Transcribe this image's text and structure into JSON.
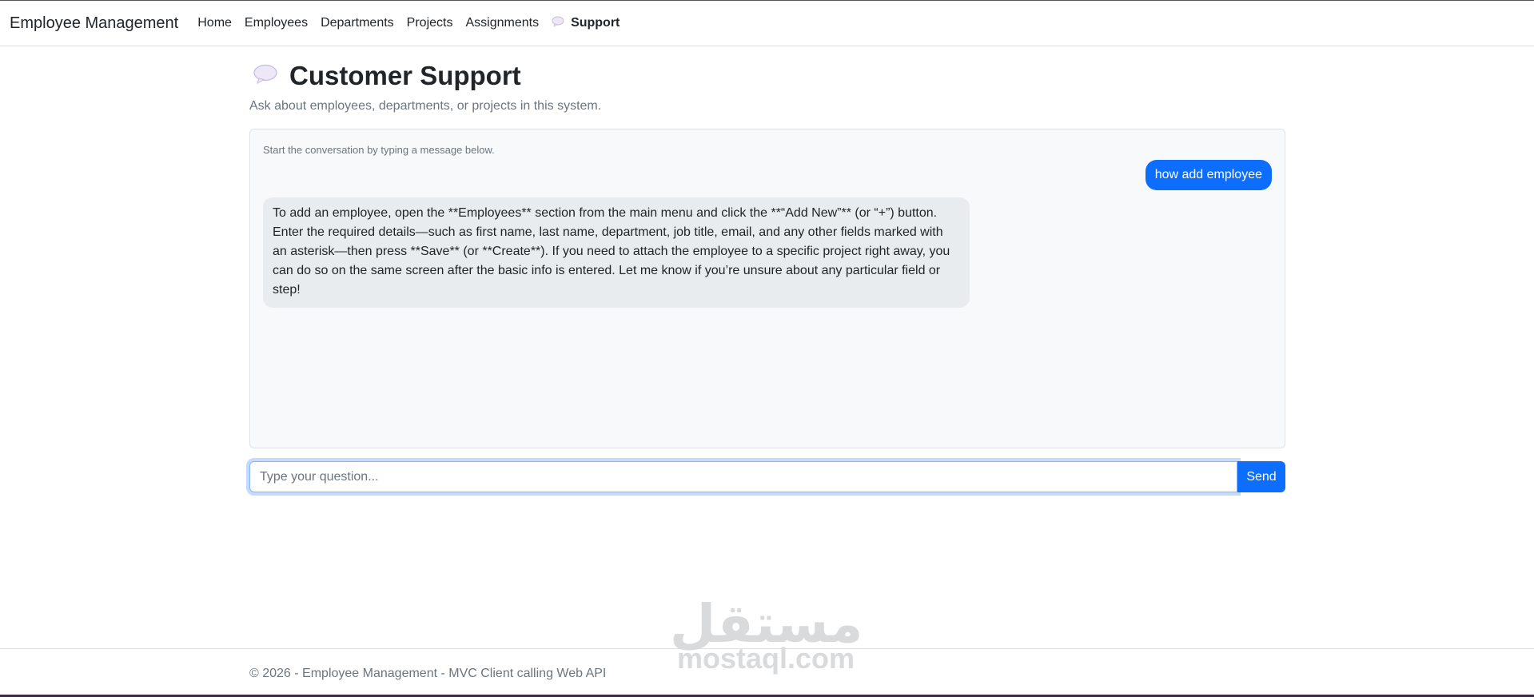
{
  "navbar": {
    "brand": "Employee Management",
    "items": [
      {
        "label": "Home"
      },
      {
        "label": "Employees"
      },
      {
        "label": "Departments"
      },
      {
        "label": "Projects"
      },
      {
        "label": "Assignments"
      },
      {
        "label": "Support",
        "icon": "speech-bubble-icon",
        "active": true
      }
    ]
  },
  "page": {
    "icon": "speech-bubble-icon",
    "title": "Customer Support",
    "subtitle": "Ask about employees, departments, or projects in this system."
  },
  "chat": {
    "hint": "Start the conversation by typing a message below.",
    "messages": [
      {
        "role": "user",
        "text": "how add employee"
      },
      {
        "role": "assistant",
        "text": "To add an employee, open the **Employees** section from the main menu and click the **“Add New”** (or “+”) button. Enter the required details—such as first name, last name, department, job title, email, and any other fields marked with an asterisk—then press **Save** (or **Create**). If you need to attach the employee to a specific project right away, you can do so on the same screen after the basic info is entered. Let me know if you’re unsure about any particular field or step!"
      }
    ],
    "input_placeholder": "Type your question...",
    "input_value": "",
    "send_label": "Send"
  },
  "footer": {
    "text": "© 2026 - Employee Management - MVC Client calling Web API"
  },
  "watermark": {
    "arabic": "مستقل",
    "latin": "mostaql.com"
  },
  "colors": {
    "primary": "#0d6efd",
    "bot_bubble": "#e9ecef",
    "chat_bg": "#f8f9fa",
    "muted_text": "#6c757d"
  }
}
